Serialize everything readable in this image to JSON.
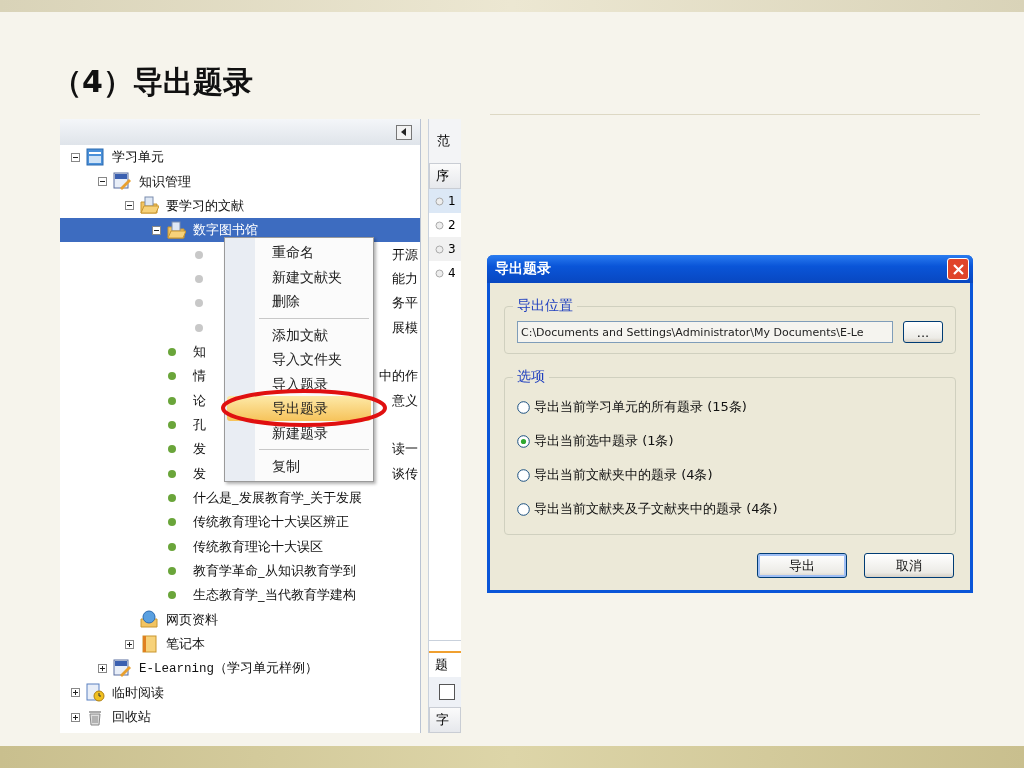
{
  "slide_title": "（4）导出题录",
  "tree": {
    "items": [
      {
        "text": "学习单元",
        "kind": "unit",
        "expanded": true,
        "selected": false,
        "children": [
          {
            "text": "知识管理",
            "kind": "topic",
            "expanded": true,
            "selected": false,
            "children": [
              {
                "text": "要学习的文献",
                "kind": "folder",
                "expanded": true,
                "selected": false,
                "children": [
                  {
                    "text": "数字图书馆",
                    "kind": "folder",
                    "expanded": true,
                    "selected": true,
                    "children": [
                      {
                        "text_right": "开源",
                        "kind": "doc",
                        "color": "#c8c8c8",
                        "selected": false
                      },
                      {
                        "text_right": "能力",
                        "kind": "doc",
                        "color": "#c8c8c8",
                        "selected": false
                      },
                      {
                        "text_right": "务平",
                        "kind": "doc",
                        "color": "#c8c8c8",
                        "selected": false
                      },
                      {
                        "text_right": "展模",
                        "kind": "doc",
                        "color": "#c8c8c8",
                        "selected": false
                      }
                    ]
                  },
                  {
                    "text": "知",
                    "kind": "doc",
                    "color": "#6aa53a",
                    "selected": false
                  },
                  {
                    "text": "情",
                    "text_right": "中的作",
                    "kind": "doc",
                    "color": "#6aa53a",
                    "selected": false
                  },
                  {
                    "text": "论",
                    "text_right": "意义",
                    "kind": "doc",
                    "color": "#6aa53a",
                    "selected": false
                  },
                  {
                    "text": "孔",
                    "kind": "doc",
                    "color": "#6aa53a",
                    "selected": false
                  },
                  {
                    "text": "发",
                    "text_right": "读一",
                    "kind": "doc",
                    "color": "#6aa53a",
                    "selected": false
                  },
                  {
                    "text": "发",
                    "text_right": "谈传",
                    "kind": "doc",
                    "color": "#6aa53a",
                    "selected": false
                  },
                  {
                    "text": "什么是_发展教育学_关于发展",
                    "kind": "doc",
                    "color": "#6aa53a",
                    "selected": false
                  },
                  {
                    "text": "传统教育理论十大误区辨正",
                    "kind": "doc",
                    "color": "#6aa53a",
                    "selected": false
                  },
                  {
                    "text": "传统教育理论十大误区",
                    "kind": "doc",
                    "color": "#6aa53a",
                    "selected": false
                  },
                  {
                    "text": "教育学革命_从知识教育学到",
                    "kind": "doc",
                    "color": "#6aa53a",
                    "selected": false
                  },
                  {
                    "text": "生态教育学_当代教育学建构",
                    "kind": "doc",
                    "color": "#6aa53a",
                    "selected": false
                  }
                ]
              },
              {
                "text": "网页资料",
                "kind": "web",
                "selected": false
              },
              {
                "text": "笔记本",
                "kind": "notebook",
                "expanded": false,
                "selected": false
              }
            ]
          },
          {
            "text": "E-Learning（学习单元样例）",
            "kind": "topic",
            "expanded": false,
            "selected": false
          }
        ]
      },
      {
        "text": "临时阅读",
        "kind": "reading",
        "expanded": false,
        "selected": false
      },
      {
        "text": "回收站",
        "kind": "trash",
        "expanded": false,
        "selected": false
      }
    ]
  },
  "context_menu": {
    "groups": [
      [
        {
          "label": "重命名",
          "selected": false
        },
        {
          "label": "新建文献夹",
          "selected": false
        },
        {
          "label": "删除",
          "selected": false
        }
      ],
      [
        {
          "label": "添加文献",
          "selected": false
        },
        {
          "label": "导入文件夹",
          "selected": false
        },
        {
          "label": "导入题录",
          "selected": false
        },
        {
          "label": "导出题录",
          "selected": true
        },
        {
          "label": "新建题录",
          "selected": false
        }
      ],
      [
        {
          "label": "复制",
          "selected": false
        }
      ]
    ]
  },
  "side_panel": {
    "label": "范",
    "column": "序",
    "rows": [
      {
        "number": "1",
        "selected": true
      },
      {
        "number": "2",
        "selected": false
      },
      {
        "number": "3",
        "selected": false
      },
      {
        "number": "4",
        "selected": false
      }
    ],
    "tab": "题",
    "checkbox_checked": false,
    "field_label": "字"
  },
  "dialog": {
    "title": "导出题录",
    "location": {
      "legend": "导出位置",
      "value": "C:\\Documents and Settings\\Administrator\\My Documents\\E-Le",
      "browse": "..."
    },
    "options": {
      "legend": "选项",
      "items": [
        {
          "label": "导出当前学习单元的所有题录 (15条)",
          "selected": false
        },
        {
          "label": "导出当前选中题录 (1条)",
          "selected": true
        },
        {
          "label": "导出当前文献夹中的题录 (4条)",
          "selected": false
        },
        {
          "label": "导出当前文献夹及子文献夹中的题录 (4条)",
          "selected": false
        }
      ]
    },
    "buttons": [
      {
        "label": "导出",
        "default": true
      },
      {
        "label": "取消",
        "default": false
      }
    ]
  }
}
